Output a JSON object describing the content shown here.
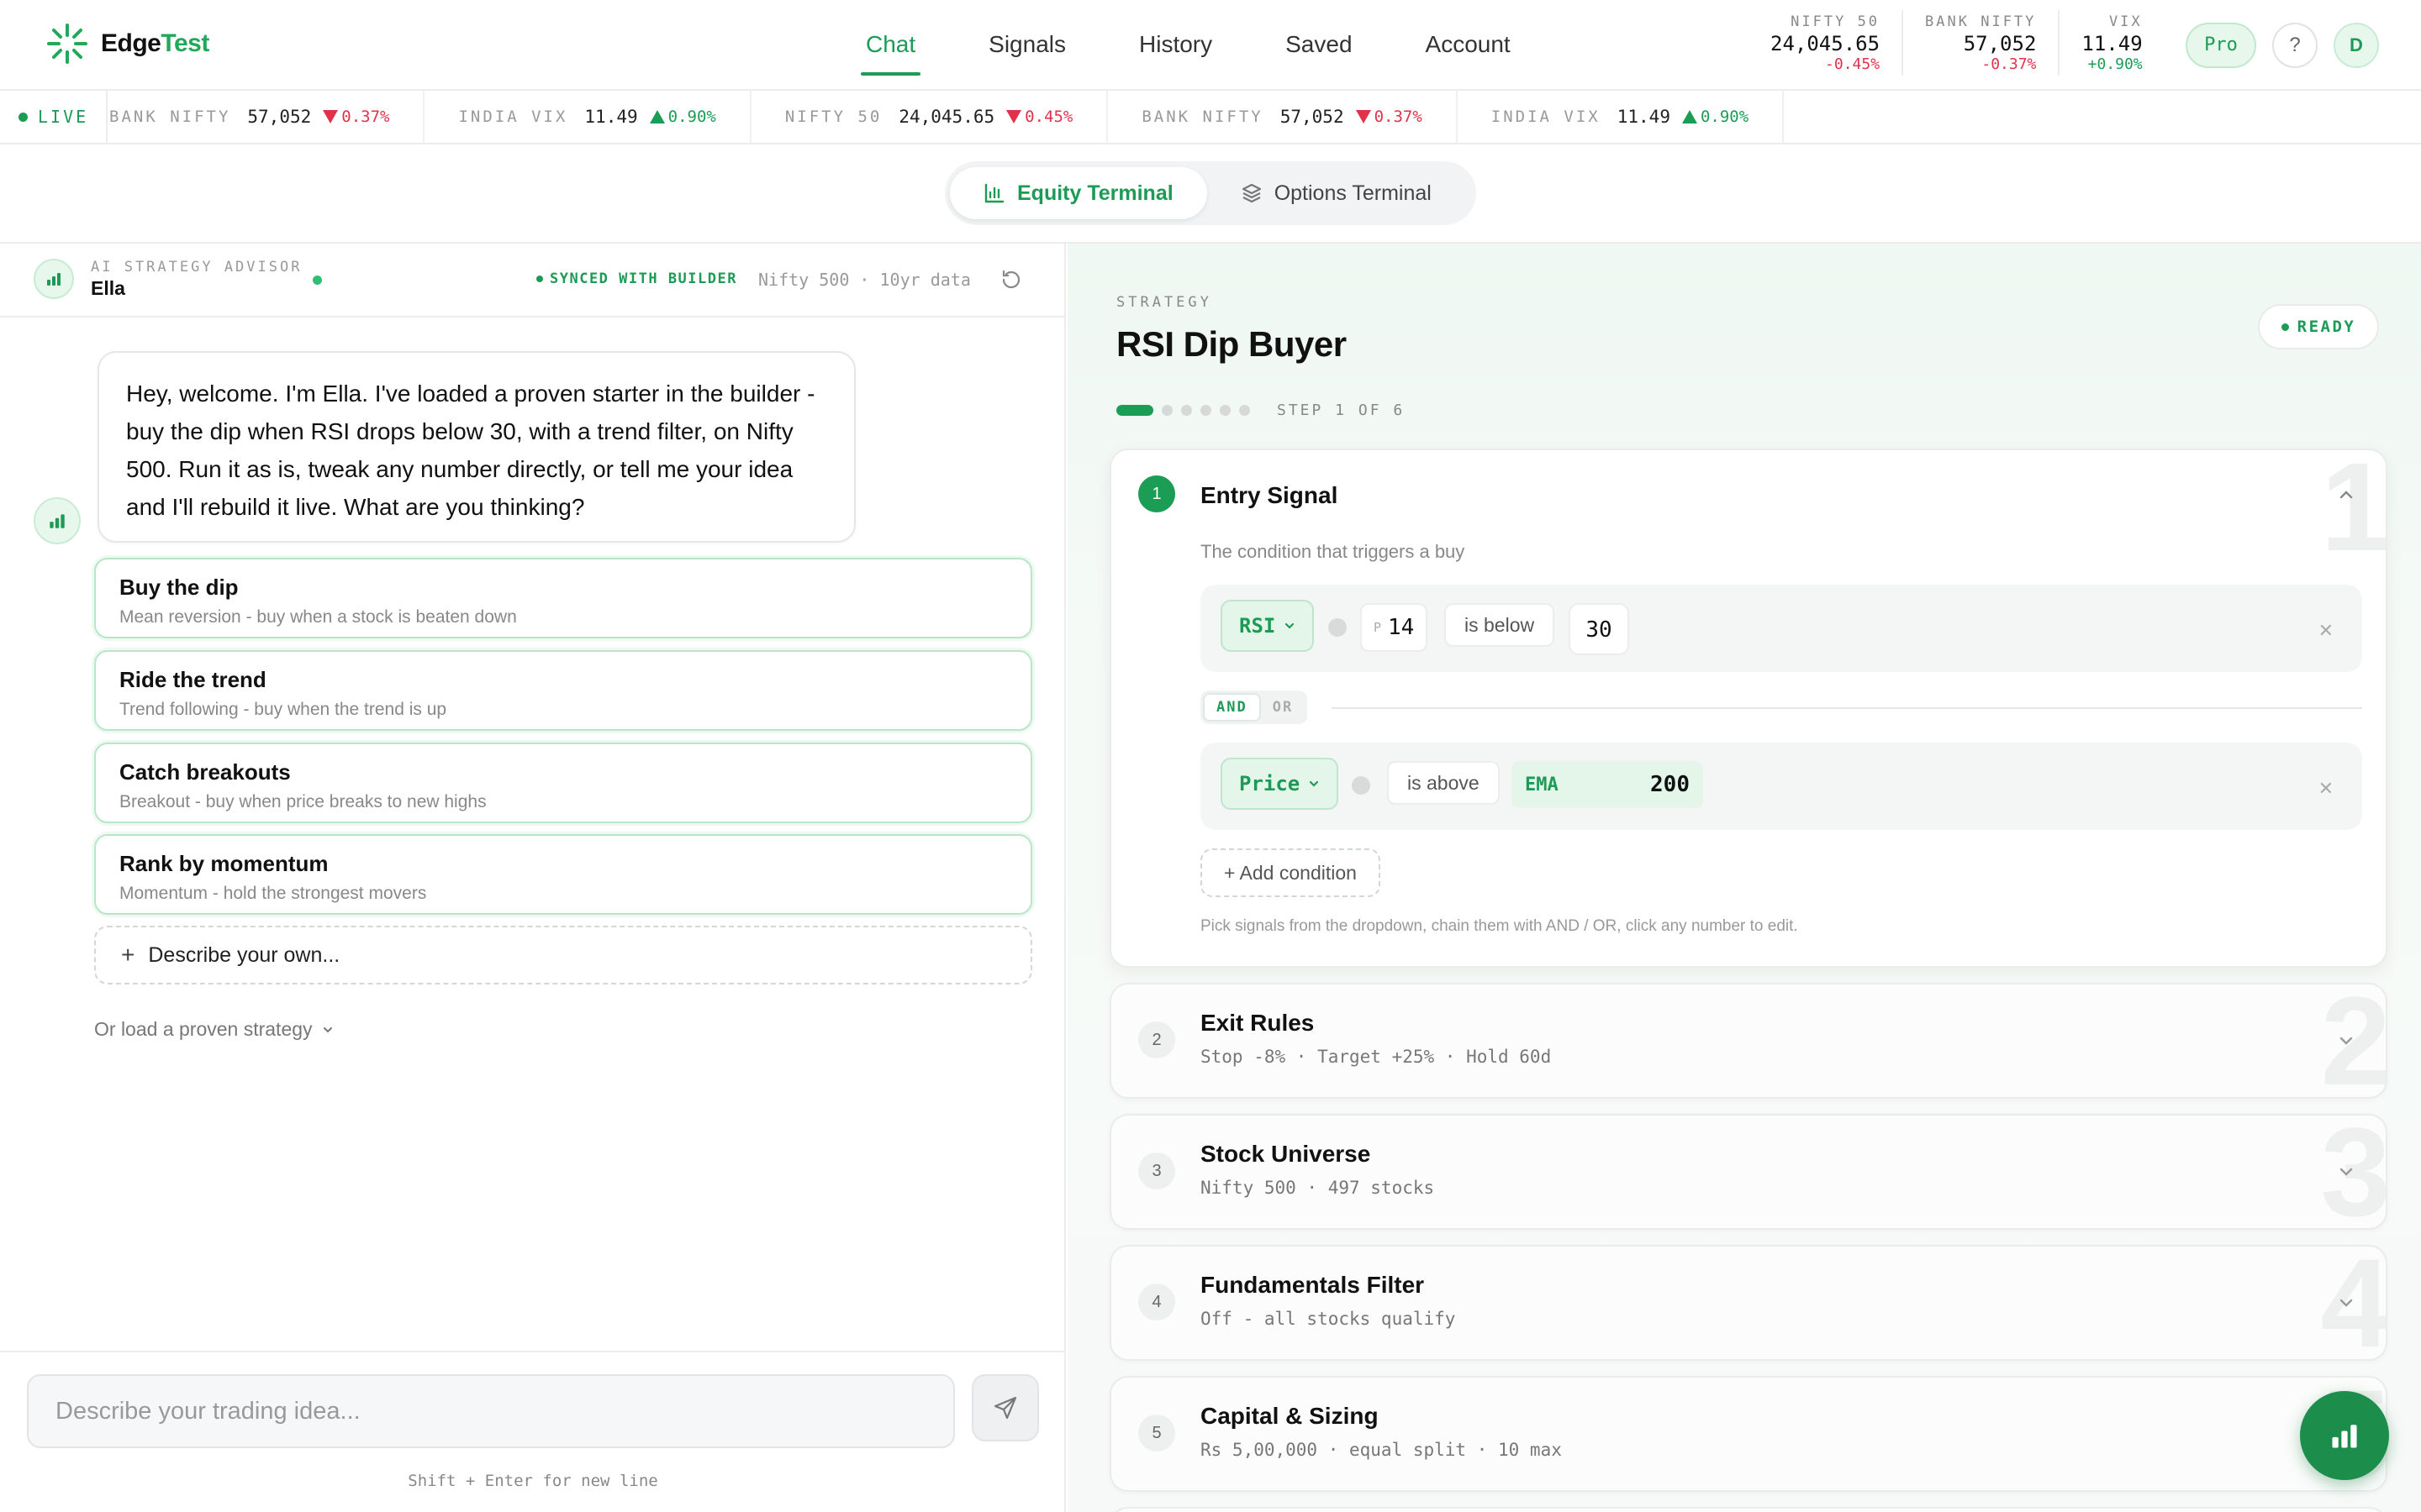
{
  "app": {
    "logo": {
      "part1": "Edge",
      "part2": "Test"
    },
    "nav": [
      "Chat",
      "Signals",
      "History",
      "Saved",
      "Account"
    ],
    "active_nav": "Chat",
    "stats": [
      {
        "label": "NIFTY 50",
        "value": "24,045.65",
        "change": "-0.45%",
        "direction": "down"
      },
      {
        "label": "BANK NIFTY",
        "value": "57,052",
        "change": "-0.37%",
        "direction": "down"
      },
      {
        "label": "VIX",
        "value": "11.49",
        "change": "+0.90%",
        "direction": "up"
      }
    ],
    "pro_label": "Pro",
    "help_label": "?",
    "avatar_initial": "D",
    "colors": {
      "accent": "#1d9b56",
      "down": "#e0334b",
      "up": "#1c9d55"
    }
  },
  "ticker": {
    "live_label": "LIVE",
    "items": [
      {
        "label": "BANK NIFTY",
        "value": "57,052",
        "change": "0.37%",
        "direction": "down"
      },
      {
        "label": "INDIA VIX",
        "value": "11.49",
        "change": "0.90%",
        "direction": "up"
      },
      {
        "label": "NIFTY 50",
        "value": "24,045.65",
        "change": "0.45%",
        "direction": "down"
      },
      {
        "label": "BANK NIFTY",
        "value": "57,052",
        "change": "0.37%",
        "direction": "down"
      },
      {
        "label": "INDIA VIX",
        "value": "11.49",
        "change": "0.90%",
        "direction": "up"
      }
    ]
  },
  "terminal_switch": {
    "equity": "Equity Terminal",
    "options": "Options Terminal",
    "active": "equity"
  },
  "chat": {
    "advisor_label": "AI STRATEGY ADVISOR",
    "advisor_name": "Ella",
    "synced_label": "SYNCED WITH BUILDER",
    "universe_info": "Nifty 500 · 10yr data",
    "welcome_message": "Hey, welcome. I'm Ella. I've loaded a proven starter in the builder - buy the dip when RSI drops below 30, with a trend filter, on Nifty 500. Run it as is, tweak any number directly, or tell me your idea and I'll rebuild it live. What are you thinking?",
    "options": [
      {
        "title": "Buy the dip",
        "subtitle": "Mean reversion - buy when a stock is beaten down"
      },
      {
        "title": "Ride the trend",
        "subtitle": "Trend following - buy when the trend is up"
      },
      {
        "title": "Catch breakouts",
        "subtitle": "Breakout - buy when price breaks to new highs"
      },
      {
        "title": "Rank by momentum",
        "subtitle": "Momentum - hold the strongest movers"
      }
    ],
    "describe_own": "Describe your own...",
    "load_proven": "Or load a proven strategy",
    "input_placeholder": "Describe your trading idea...",
    "input_hint": "Shift + Enter for new line"
  },
  "builder": {
    "label": "STRATEGY",
    "name": "RSI Dip Buyer",
    "status": "READY",
    "step_text": "STEP 1 OF 6",
    "step_total": 6,
    "step_current": 1,
    "cards": [
      {
        "num": "1",
        "title": "Entry Signal",
        "subtitle": "The condition that triggers a buy",
        "open": true
      },
      {
        "num": "2",
        "title": "Exit Rules",
        "subtitle": "Stop -8% · Target +25% · Hold 60d"
      },
      {
        "num": "3",
        "title": "Stock Universe",
        "subtitle": "Nifty 500 · 497 stocks"
      },
      {
        "num": "4",
        "title": "Fundamentals Filter",
        "subtitle": "Off - all stocks qualify"
      },
      {
        "num": "5",
        "title": "Capital & Sizing",
        "subtitle": "Rs 5,00,000 · equal split · 10 max"
      }
    ],
    "conditions": [
      {
        "indicator": "RSI",
        "param_label": "P",
        "param_value": "14",
        "operator": "is below",
        "value": "30"
      },
      {
        "indicator": "Price",
        "operator": "is above",
        "ref_label": "EMA",
        "ref_value": "200"
      }
    ],
    "logic": {
      "and": "AND",
      "or": "OR",
      "active": "AND"
    },
    "add_condition": "+ Add condition",
    "help_text": "Pick signals from the dropdown, chain them with AND / OR, click any number to edit."
  }
}
